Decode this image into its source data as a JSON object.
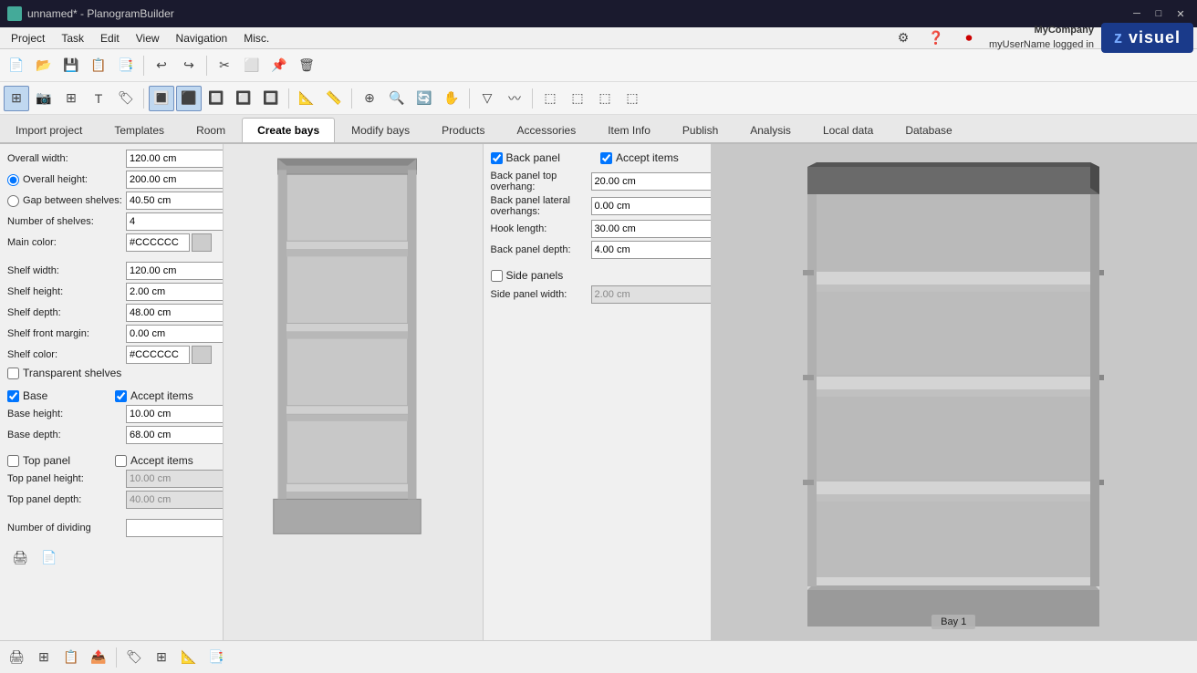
{
  "titlebar": {
    "title": "unnamed* - PlanogramBuilder",
    "icon": "🗂",
    "controls": [
      "minimize",
      "maximize",
      "close"
    ]
  },
  "menubar": {
    "items": [
      "Project",
      "Task",
      "Edit",
      "View",
      "Navigation",
      "Misc."
    ]
  },
  "topright": {
    "company_name": "MyCompany",
    "user_text": "myUserName logged in",
    "logo": "z visuel"
  },
  "tabs": {
    "items": [
      "Import project",
      "Templates",
      "Room",
      "Create bays",
      "Modify bays",
      "Products",
      "Accessories",
      "Item Info",
      "Publish",
      "Analysis",
      "Local data",
      "Database"
    ],
    "active": "Create bays"
  },
  "fields": {
    "overall_width_label": "Overall width:",
    "overall_width_value": "120.00 cm",
    "overall_height_label": "Overall height:",
    "overall_height_value": "200.00 cm",
    "gap_between_shelves_label": "Gap between shelves:",
    "gap_between_shelves_value": "40.50 cm",
    "number_of_shelves_label": "Number of shelves:",
    "number_of_shelves_value": "4",
    "main_color_label": "Main color:",
    "main_color_value": "#CCCCCC",
    "shelf_width_label": "Shelf width:",
    "shelf_width_value": "120.00 cm",
    "shelf_height_label": "Shelf height:",
    "shelf_height_value": "2.00 cm",
    "shelf_depth_label": "Shelf depth:",
    "shelf_depth_value": "48.00 cm",
    "shelf_front_margin_label": "Shelf front margin:",
    "shelf_front_margin_value": "0.00 cm",
    "shelf_color_label": "Shelf color:",
    "shelf_color_value": "#CCCCCC",
    "transparent_shelves_label": "Transparent shelves",
    "base_label": "Base",
    "base_checked": true,
    "accept_items_base_label": "Accept items",
    "accept_items_base_checked": true,
    "base_height_label": "Base height:",
    "base_height_value": "10.00 cm",
    "base_depth_label": "Base depth:",
    "base_depth_value": "68.00 cm",
    "top_panel_label": "Top panel",
    "top_panel_checked": false,
    "accept_items_top_label": "Accept items",
    "accept_items_top_checked": false,
    "top_panel_height_label": "Top panel height:",
    "top_panel_height_value": "10.00 cm",
    "top_panel_depth_label": "Top panel depth:",
    "top_panel_depth_value": "40.00 cm",
    "number_of_dividing_label": "Number of dividing",
    "back_panel_label": "Back panel",
    "back_panel_checked": true,
    "accept_items_back_label": "Accept items",
    "accept_items_back_checked": true,
    "back_panel_top_overhang_label": "Back panel top overhang:",
    "back_panel_top_overhang_value": "20.00 cm",
    "back_panel_lateral_label": "Back panel lateral overhangs:",
    "back_panel_lateral_value": "0.00 cm",
    "hook_length_label": "Hook length:",
    "hook_length_value": "30.00 cm",
    "back_panel_depth_label": "Back panel depth:",
    "back_panel_depth_value": "4.00 cm",
    "side_panels_label": "Side panels",
    "side_panels_checked": false,
    "side_panel_width_label": "Side panel width:",
    "side_panel_width_value": "2.00 cm"
  },
  "bay_label": "Bay 1",
  "colors": {
    "main_color_hex": "#CCCCCC",
    "shelf_color_hex": "#CCCCCC",
    "accent": "#1a3a8a"
  }
}
